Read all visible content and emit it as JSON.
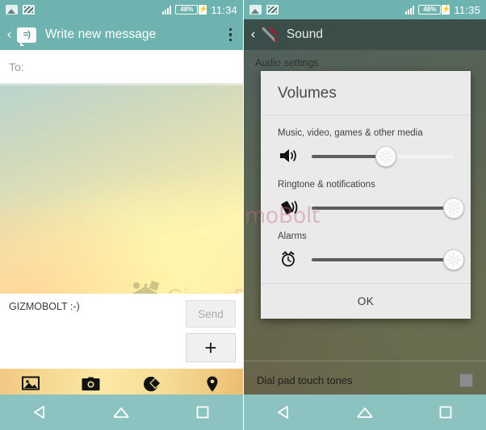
{
  "left_phone": {
    "status_bar": {
      "time": "11:34",
      "battery_percent": "48%",
      "icons": [
        "screenshot-icon",
        "messaging-icon",
        "signal-icon",
        "battery-charging-icon"
      ]
    },
    "app_bar": {
      "back_label": "‹",
      "badge_label": "=)",
      "title": "Write new message",
      "overflow_label": "more-options"
    },
    "recipient_field": {
      "label": "To:",
      "value": ""
    },
    "canvas": {
      "watermark_text": "GizmoBolt"
    },
    "compose": {
      "message_text": "GIZMOBOLT :-)",
      "send_label": "Send",
      "add_label": "+"
    },
    "attachments": [
      {
        "name": "gallery-icon",
        "label": "Gallery"
      },
      {
        "name": "camera-icon",
        "label": "Camera"
      },
      {
        "name": "sketch-icon",
        "label": "Sketch"
      },
      {
        "name": "location-icon",
        "label": "Location"
      }
    ],
    "nav_bar": [
      {
        "name": "nav-back",
        "label": "Back"
      },
      {
        "name": "nav-home",
        "label": "Home"
      },
      {
        "name": "nav-recents",
        "label": "Recents"
      }
    ]
  },
  "right_phone": {
    "status_bar": {
      "time": "11:35",
      "battery_percent": "48%",
      "icons": [
        "screenshot-icon",
        "messaging-icon",
        "signal-icon",
        "battery-charging-icon"
      ]
    },
    "app_bar": {
      "back_label": "‹",
      "title": "Sound"
    },
    "settings_list": {
      "section_label": "Audio settings",
      "row_label": "Dial pad touch tones",
      "checkbox_state": "unchecked"
    },
    "dialog": {
      "title": "Volumes",
      "ok_label": "OK",
      "sliders": [
        {
          "label": "Music, video, games & other media",
          "icon": "speaker-icon",
          "value_percent": 52
        },
        {
          "label": "Ringtone & notifications",
          "icon": "vibrate-ring-icon",
          "value_percent": 100
        },
        {
          "label": "Alarms",
          "icon": "alarm-clock-icon",
          "value_percent": 100
        }
      ]
    },
    "watermark_text": "moBolt",
    "nav_bar": [
      {
        "name": "nav-back",
        "label": "Back"
      },
      {
        "name": "nav-home",
        "label": "Home"
      },
      {
        "name": "nav-recents",
        "label": "Recents"
      }
    ]
  },
  "colors": {
    "status_bar": "#6fb3b1",
    "app_bar_left": "#6fb3b1",
    "nav_bar": "#8cc2c0",
    "dialog_bg": "#eaeaea",
    "slider_fill": "#5c5c5c",
    "watermark": "#c96a86"
  }
}
